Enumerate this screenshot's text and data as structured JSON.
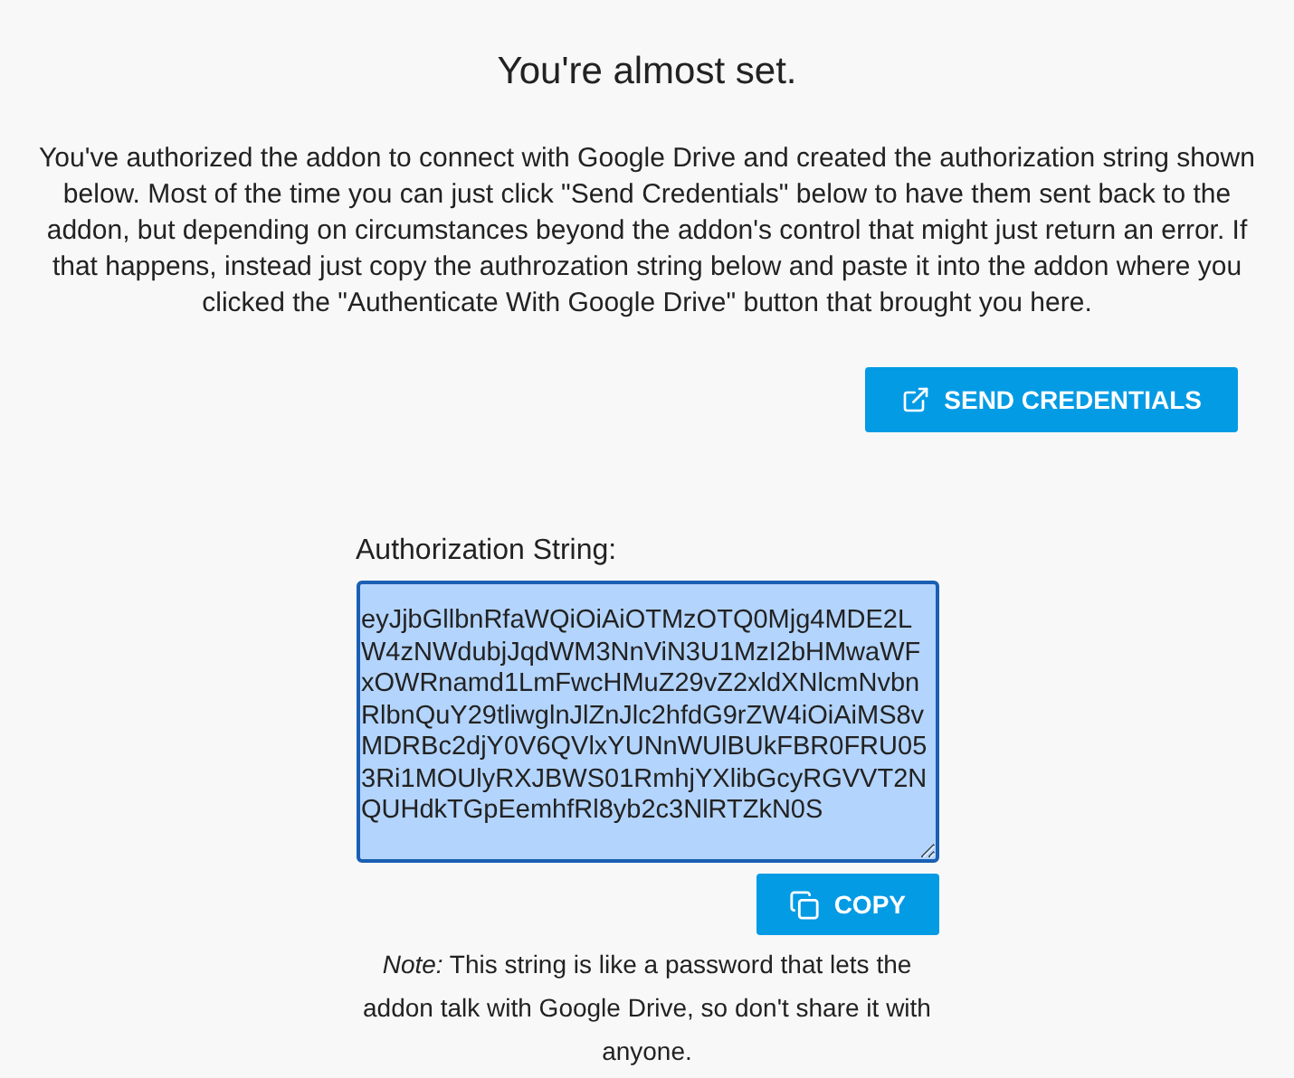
{
  "title": "You're almost set.",
  "intro": "You've authorized the addon to connect with Google Drive and created the authorization string shown below. Most of the time you can just click \"Send Credentials\" below to have them sent back to the addon, but depending on circumstances beyond the addon's control that might just return an error. If that happens, instead just copy the authrozation string below and paste it into the addon where you clicked the \"Authenticate With Google Drive\" button that brought you here.",
  "send_button": "SEND CREDENTIALS",
  "auth_field": {
    "label": "Authorization String:",
    "value": "eyJjbGllbnRfaWQiOiAiOTMzOTQ0Mjg4MDE2LW4zNWdubjJqdWM3NnViN3U1MzI2bHMwaWFxOWRnamd1LmFwcHMuZ29vZ2xldXNlcmNvbnRlbnQuY29tliwglnJlZnJlc2hfdG9rZW4iOiAiMS8vMDRBc2djY0V6QVlxYUNnWUlBUkFBR0FRU053Ri1MOUlyRXJBWS01RmhjYXlibGcyRGVVT2NQUHdkTGpEemhfRl8yb2c3NlRTZkN0S",
    "highlighted": true
  },
  "copy_button": "COPY",
  "note": "*Note:* This string is like a password that lets the addon talk with Google Drive, so don't share it with anyone."
}
